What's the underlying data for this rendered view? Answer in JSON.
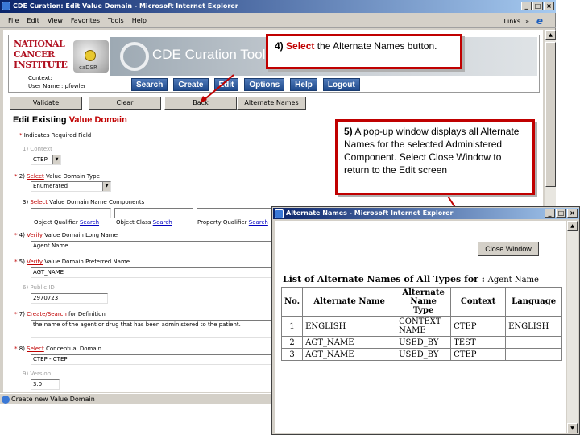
{
  "window": {
    "title": "CDE Curation: Edit Value Domain - Microsoft Internet Explorer",
    "menu": [
      "File",
      "Edit",
      "View",
      "Favorites",
      "Tools",
      "Help"
    ],
    "links_label": "Links",
    "links_chevron": "»",
    "status": "Create new Value Domain"
  },
  "header": {
    "nci_logo": [
      "NATIONAL",
      "CANCER",
      "INSTITUTE"
    ],
    "cadsr_label": "caDSR",
    "banner_title": "CDE Curation Tool",
    "context_label": "Context:",
    "user_label": "User Name : pfowler",
    "nav": [
      "Search",
      "Create",
      "Edit",
      "Options",
      "Help",
      "Logout"
    ]
  },
  "toolbar": {
    "validate": "Validate",
    "clear": "Clear",
    "back": "Back",
    "alternate_names": "Alternate Names"
  },
  "form": {
    "title_prefix": "Edit Existing ",
    "title_red": "Value Domain",
    "required_note": "Indicates Required Field",
    "context_label": "1) Context",
    "context_value": "CTEP",
    "vd_type_num": "2) ",
    "vd_type_link": "Select",
    "vd_type_label": " Value Domain Type",
    "vd_type_value": "Enumerated",
    "name_comp_num": "3) ",
    "name_comp_link": "Select",
    "name_comp_label": " Value Domain Name Components",
    "oq_label": "Object Qualifier ",
    "oc_label": "Object Class ",
    "pq_label": "Property Qualifier ",
    "search_link": "Search",
    "long_name_num": "4) ",
    "long_name_link": "Verify",
    "long_name_label": " Value Domain Long Name",
    "long_name_value": "Agent Name",
    "pref_name_num": "5) ",
    "pref_name_link": "Verify",
    "pref_name_label": " Value Domain Preferred Name",
    "pref_name_value": "AGT_NAME",
    "public_id_label": "6) Public ID",
    "public_id_value": "2970723",
    "def_num": "7) ",
    "def_link": "Create/Search",
    "def_label": " for Definition",
    "def_value": "the name of the agent or drug that has been administered to the patient.",
    "cd_num": "8) ",
    "cd_link": "Select",
    "cd_label": " Conceptual Domain",
    "cd_value": "CTEP - CTEP",
    "version_label": "9) Version",
    "version_value": "3.0"
  },
  "callout1": {
    "num": "4)",
    "action": "Select",
    "text": "the Alternate Names button."
  },
  "callout2": {
    "num": "5)",
    "text": "A pop-up window displays all Alternate Names for the selected Administered Component. Select Close Window to return to the Edit screen"
  },
  "popup": {
    "title": "Alternate Names - Microsoft Internet Explorer",
    "close_button": "Close Window",
    "list_title": "List of Alternate Names of All Types for : ",
    "list_subject": "Agent Name",
    "columns": [
      "No.",
      "Alternate Name",
      "Alternate Name Type",
      "Context",
      "Language"
    ],
    "rows": [
      [
        "1",
        "ENGLISH",
        "CONTEXT NAME",
        "CTEP",
        "ENGLISH"
      ],
      [
        "2",
        "AGT_NAME",
        "USED_BY",
        "TEST",
        ""
      ],
      [
        "3",
        "AGT_NAME",
        "USED_BY",
        "CTEP",
        ""
      ]
    ]
  },
  "colors": {
    "accent_red": "#c00000",
    "title_blue": "#0a246a",
    "nav_blue": "#1f4a8c"
  }
}
